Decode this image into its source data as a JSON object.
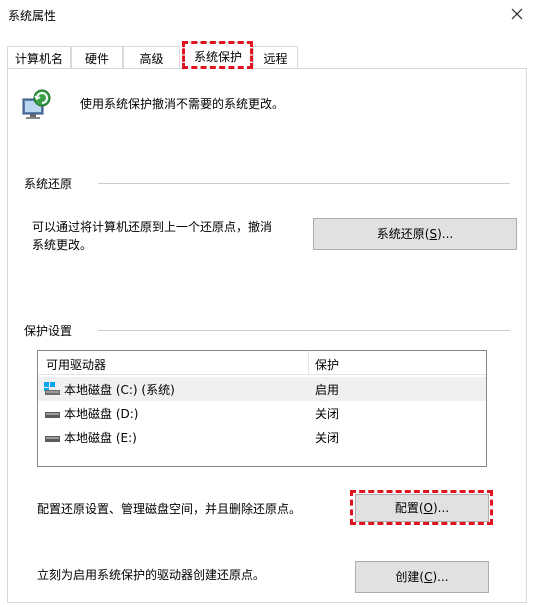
{
  "window": {
    "title": "系统属性"
  },
  "tabs": [
    {
      "label": "计算机名"
    },
    {
      "label": "硬件"
    },
    {
      "label": "高级"
    },
    {
      "label": "系统保护"
    },
    {
      "label": "远程"
    }
  ],
  "intro": {
    "text": "使用系统保护撤消不需要的系统更改。"
  },
  "restore": {
    "group_label": "系统还原",
    "description_line1": "可以通过将计算机还原到上一个还原点，撤消",
    "description_line2": "系统更改。",
    "button_text": "系统还原(",
    "button_key": "S",
    "button_suffix": ")..."
  },
  "protection": {
    "group_label": "保护设置",
    "columns": [
      "可用驱动器",
      "保护"
    ],
    "drives": [
      {
        "name": "本地磁盘 (C:) (系统)",
        "status": "启用"
      },
      {
        "name": "本地磁盘 (D:)",
        "status": "关闭"
      },
      {
        "name": "本地磁盘 (E:)",
        "status": "关闭"
      }
    ],
    "configure_desc": "配置还原设置、管理磁盘空间，并且删除还原点。",
    "configure_text": "配置(",
    "configure_key": "O",
    "configure_suffix": ")...",
    "create_desc": "立刻为启用系统保护的驱动器创建还原点。",
    "create_text": "创建(",
    "create_key": "C",
    "create_suffix": ")..."
  },
  "colors": {
    "highlight": "#e0141e",
    "button_bg": "#e1e1e1",
    "selected_row": "#f0f0f0"
  }
}
